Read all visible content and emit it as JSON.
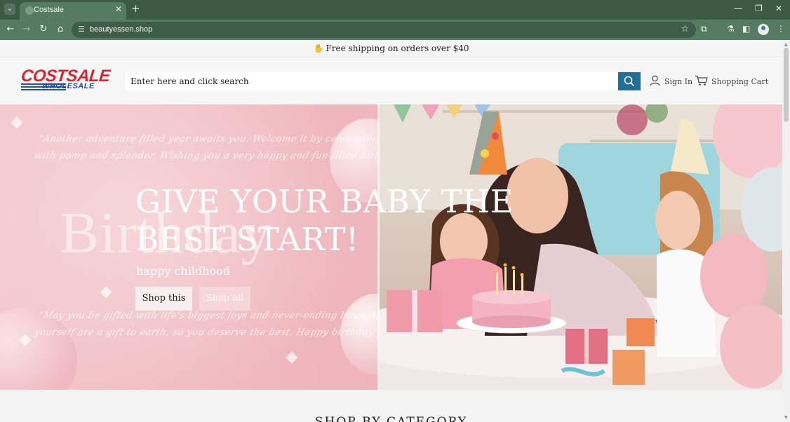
{
  "browser": {
    "tab_title": "Costsale",
    "url": "beautyessen.shop",
    "icons": [
      "tab-search-icon",
      "favicon-icon",
      "close-icon",
      "plus-icon",
      "minimize-icon",
      "restore-icon",
      "window-close-icon",
      "back-icon",
      "forward-icon",
      "reload-icon",
      "home-icon",
      "site-info-icon",
      "star-icon",
      "extensions-icon",
      "labs-icon",
      "sidebar-icon",
      "profile-icon",
      "menu-icon"
    ]
  },
  "announcement": {
    "icon": "hand-icon",
    "text": "Free shipping on orders over $40"
  },
  "header": {
    "logo_top": "COSTSALE",
    "logo_bottom": "WHOLESALE",
    "search_placeholder": "Enter here and click search",
    "sign_in": "Sign In",
    "cart": "Shopping Cart"
  },
  "hero": {
    "title": "GIVE YOUR BABY THE BEST START!",
    "subtitle": "happy childhood",
    "primary_button": "Shop this",
    "secondary_button": "Shop all",
    "watermark": "Birthday",
    "script_top_1": "\"Another adventure filled year awaits you. Welcome it by celebrating your birthday",
    "script_top_2": "with pomp and splendor. Wishing you a very happy and fun-filled birthday!\"",
    "script_bottom_1": "\"May you be gifted with life's biggest joys and never-ending bliss. After all, you",
    "script_bottom_2": "yourself are a gift to earth, so you deserve the best. Happy birthday.\""
  },
  "sections": {
    "category_title": "SHOP BY CATEGORY"
  },
  "colors": {
    "chrome": "#3d5a45",
    "toolbar": "#557b63",
    "search_button": "#1f6f9a",
    "logo_red": "#d7262e",
    "logo_blue": "#1f4fa6",
    "hero_pink": "#efb7bd"
  }
}
